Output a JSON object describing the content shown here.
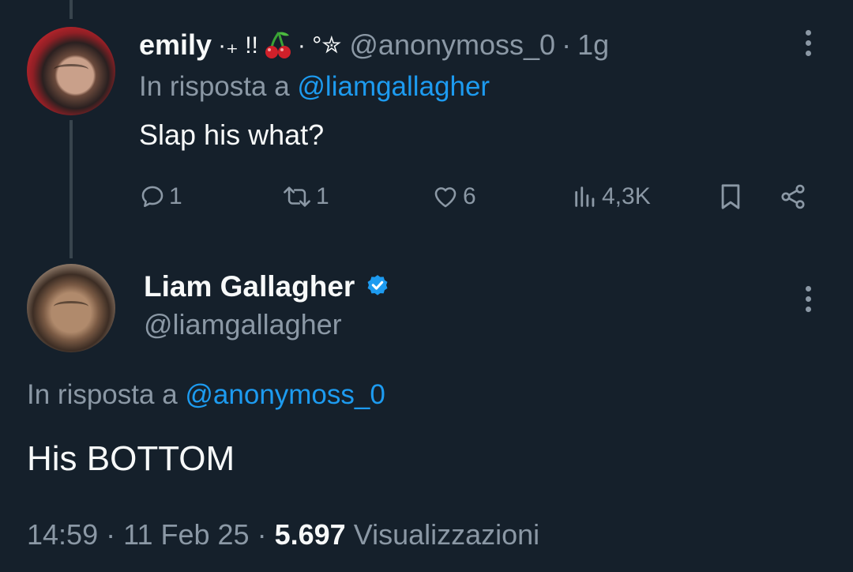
{
  "reply_tweet": {
    "author_name": "emily",
    "author_decor_pre": "·₊ !!",
    "author_decor_post": "· °✮",
    "handle": "@anonymoss_0",
    "separator": "·",
    "time": "1g",
    "in_reply_label": "In risposta a",
    "in_reply_mention": "@liamgallagher",
    "text": "Slap his what?",
    "stats": {
      "replies": "1",
      "reposts": "1",
      "likes": "6",
      "views": "4,3K"
    }
  },
  "main_tweet": {
    "author_name": "Liam Gallagher",
    "handle": "@liamgallagher",
    "in_reply_label": "In risposta a",
    "in_reply_mention": "@anonymoss_0",
    "text": "His BOTTOM",
    "meta": {
      "time": "14:59",
      "sep1": "·",
      "date": "11 Feb 25",
      "sep2": "·",
      "views_count": "5.697",
      "views_label": "Visualizzazioni"
    }
  },
  "icons": {
    "reply": "comment-icon",
    "repost": "repost-icon",
    "like": "heart-icon",
    "views": "analytics-icon",
    "bookmark": "bookmark-icon",
    "share": "share-icon",
    "more": "more-vertical-icon",
    "verified": "verified-badge-icon",
    "emoji": "cherries-emoji"
  },
  "colors": {
    "background": "#15202b",
    "text_primary": "#f7f9f9",
    "text_secondary": "#8b98a5",
    "accent": "#1d9bf0",
    "thread_line": "#38444d"
  }
}
